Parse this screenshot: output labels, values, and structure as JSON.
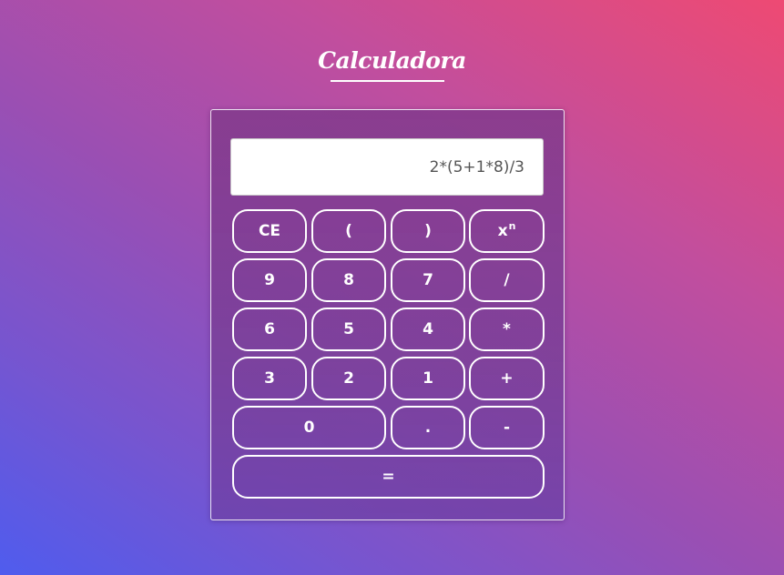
{
  "title": "Calculadora",
  "display": {
    "value": "2*(5+1*8)/3"
  },
  "buttons": {
    "ce": "CE",
    "open_paren": "(",
    "close_paren": ")",
    "power_base": "x",
    "power_exp": "n",
    "nine": "9",
    "eight": "8",
    "seven": "7",
    "divide": "/",
    "six": "6",
    "five": "5",
    "four": "4",
    "multiply": "*",
    "three": "3",
    "two": "2",
    "one": "1",
    "plus": "+",
    "zero": "0",
    "dot": ".",
    "minus": "-",
    "equals": "="
  },
  "colors": {
    "gradient_start": "#4f5cee",
    "gradient_end": "#ee4a73",
    "button_border": "#ffffff",
    "display_text": "#555555"
  }
}
